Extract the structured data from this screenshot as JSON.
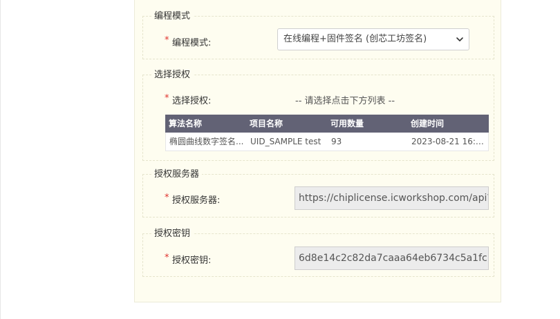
{
  "sections": {
    "mode": {
      "legend": "编程模式",
      "required": "*",
      "label": "编程模式:",
      "selected": "在线编程+固件签名 (创芯工坊签名)"
    },
    "auth": {
      "legend": "选择授权",
      "required": "*",
      "label": "选择授权:",
      "hint": "-- 请选择点击下方列表 --",
      "table": {
        "headers": [
          "算法名称",
          "项目名称",
          "可用数量",
          "创建时间"
        ],
        "rows": [
          [
            "椭圆曲线数字签名...",
            "UID_SAMPLE test",
            "93",
            "2023-08-21 16:1..."
          ]
        ]
      }
    },
    "server": {
      "legend": "授权服务器",
      "required": "*",
      "label": "授权服务器:",
      "value": "https://chiplicense.icworkshop.com/api?"
    },
    "key": {
      "legend": "授权密钥",
      "required": "*",
      "label": "授权密钥:",
      "value": "6d8e14c2c82da7caaa64eb6734c5a1fc"
    }
  },
  "colors": {
    "panel_bg": "#fefdf0",
    "required": "#e0322d",
    "table_header_bg": "#626275",
    "readonly_bg": "#ececec"
  },
  "icons": {
    "select_arrow": "chevron-down-icon"
  }
}
